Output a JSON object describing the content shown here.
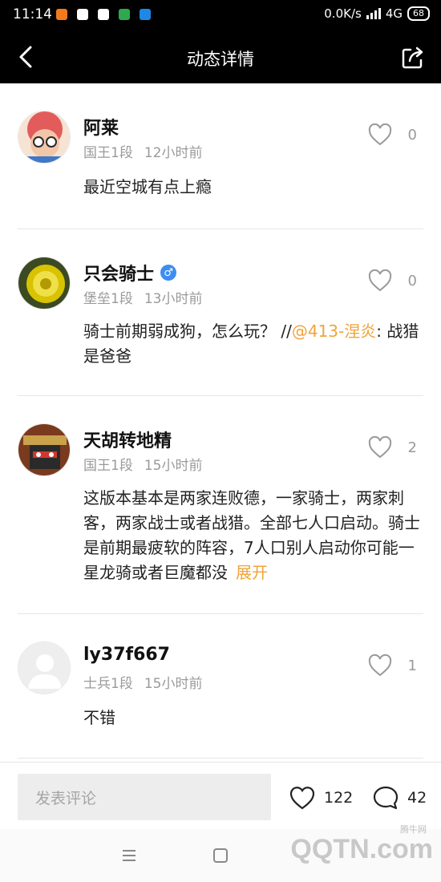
{
  "status_bar": {
    "time": "11:14",
    "speed": "0.0K/s",
    "network": "4G",
    "battery": "68",
    "notif_colors": [
      "#f07a1c",
      "#ffffff",
      "#ffffff",
      "#2fa84f",
      "#1e88e5"
    ]
  },
  "header": {
    "title": "动态详情",
    "back_icon": "back-arrow-icon",
    "share_icon": "share-icon"
  },
  "comments": [
    {
      "name": "阿莱",
      "rank": "国王1段",
      "time": "12小时前",
      "likes": "0",
      "text": "最近空城有点上瘾",
      "avatar_color": "#e25c5c"
    },
    {
      "name": "只会骑士",
      "gender": "♂",
      "rank": "堡垒1段",
      "time": "13小时前",
      "likes": "0",
      "text_before": "骑士前期弱成狗，怎么玩？ //",
      "mention": "@413-涅炎",
      "text_after": ": 战猎是爸爸",
      "avatar_color": "#d9c200"
    },
    {
      "name": "天胡转地精",
      "rank": "国王1段",
      "time": "15小时前",
      "likes": "2",
      "text": "这版本基本是两家连败德，一家骑士，两家刺客，两家战士或者战猎。全部七人口启动。骑士是前期最疲软的阵容，7人口别人启动你可能一星龙骑或者巨魔都没",
      "expand": "展开",
      "avatar_color": "#7a3a1e"
    },
    {
      "name": "ly37f667",
      "rank": "士兵1段",
      "time": "15小时前",
      "likes": "1",
      "text": "不错",
      "avatar_color": "#e0e0e0"
    }
  ],
  "bottom_bar": {
    "placeholder": "发表评论",
    "like_count": "122",
    "comment_count": "42"
  },
  "watermark": {
    "brand": "QQTN.com",
    "sub": "腾牛网"
  }
}
